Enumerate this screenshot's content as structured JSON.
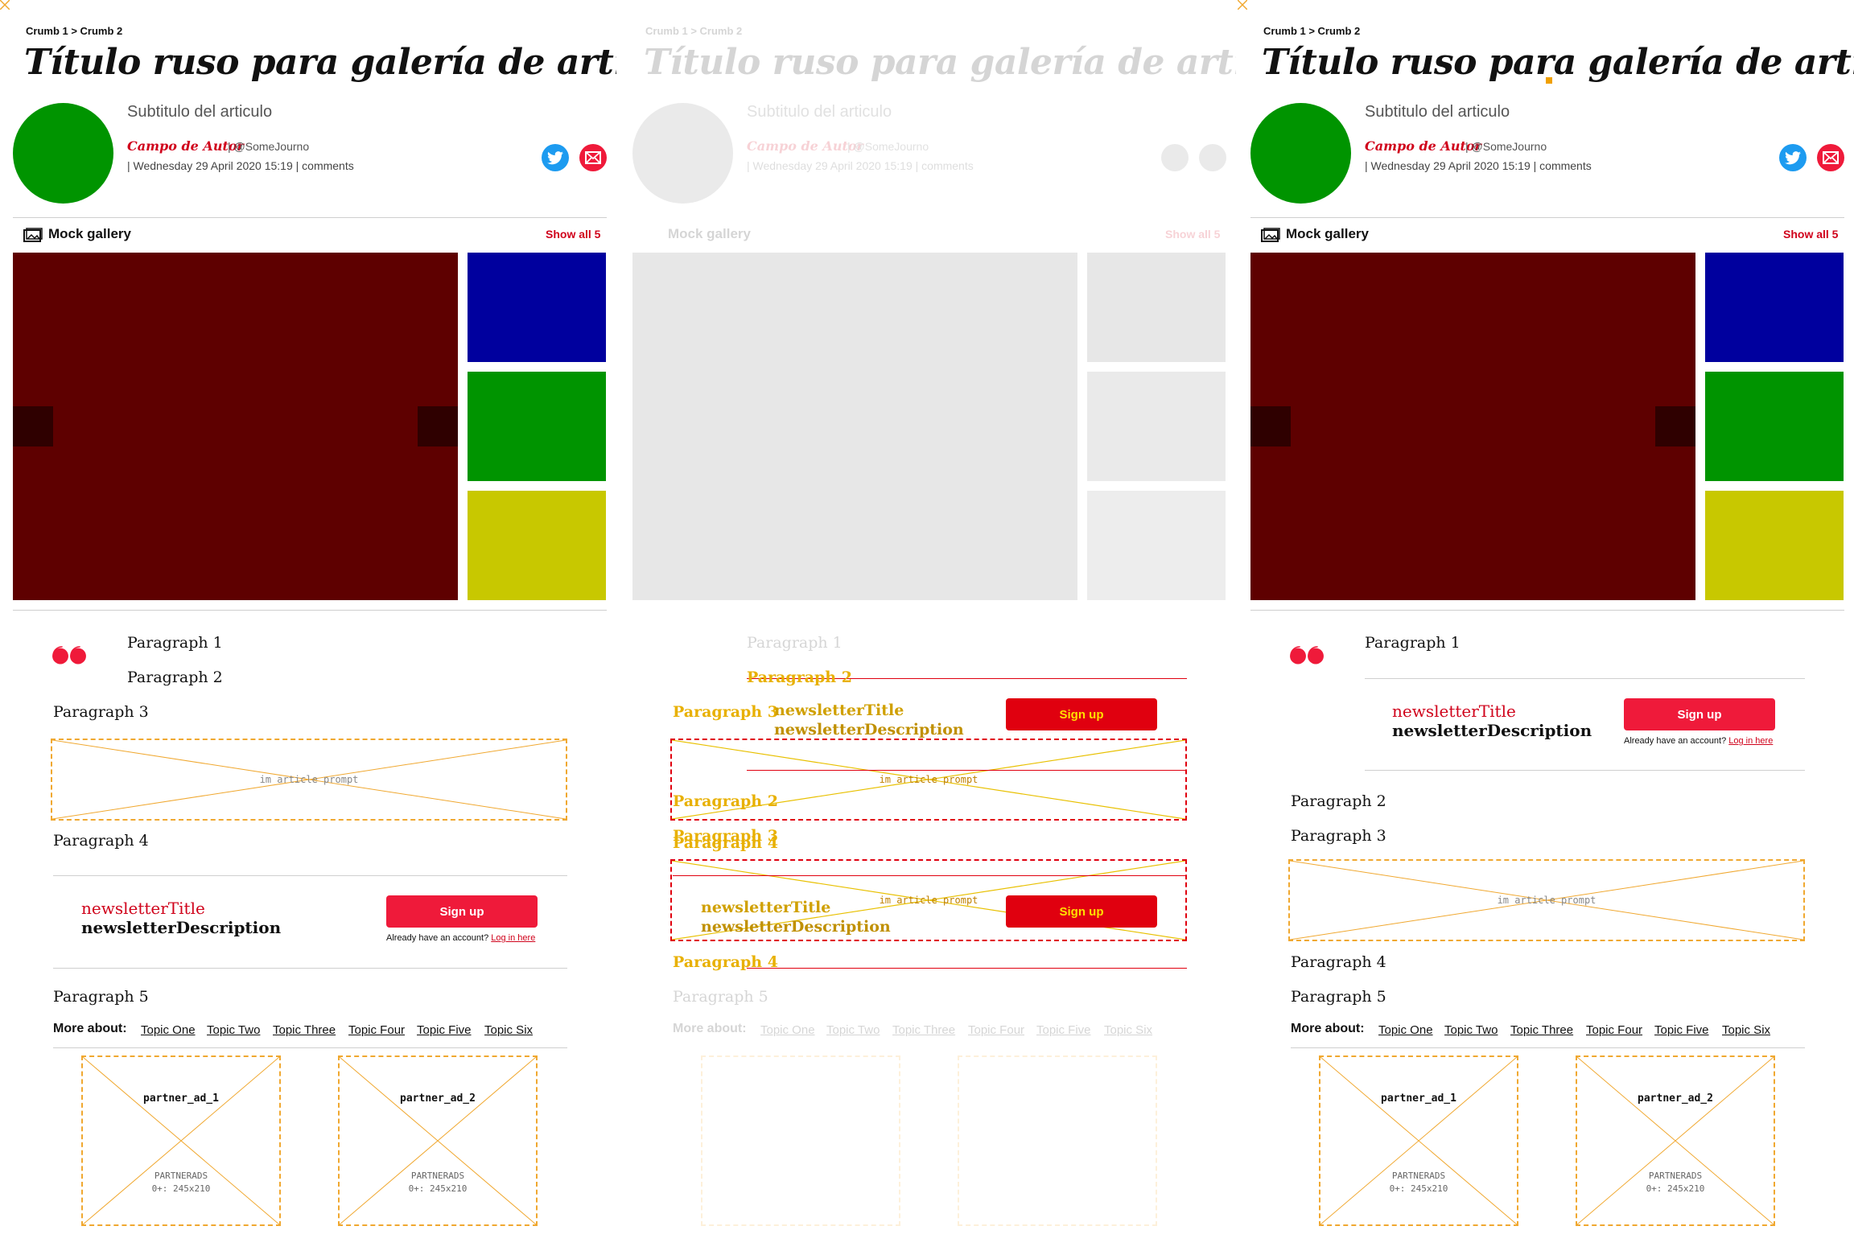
{
  "article": {
    "breadcrumb": "Crumb 1 > Crumb 2",
    "title": "Título ruso para galería de artículos",
    "subtitle": "Subtitulo del articulo",
    "author": "Campo de Autor",
    "handle": "| @SomeJourno",
    "meta": "| Wednesday 29 April 2020 15:19 |  comments"
  },
  "gallery": {
    "label": "Mock gallery",
    "show_all": "Show all 5",
    "colors": {
      "main": "#5e0000",
      "thumb1": "#00009e",
      "thumb2": "#009400",
      "thumb3": "#c8c800"
    }
  },
  "body": {
    "p1": "Paragraph 1",
    "p2": "Paragraph 2",
    "p3": "Paragraph 3",
    "p4": "Paragraph 4",
    "p5": "Paragraph 5",
    "prompt_label": "im article prompt"
  },
  "newsletter": {
    "title": "newsletterTitle",
    "description": "newsletterDescription",
    "signup": "Sign up",
    "already": "Already have an account?",
    "login": "Log in here"
  },
  "more_about": {
    "label": "More about:",
    "topics": [
      "Topic One",
      "Topic Two",
      "Topic Three",
      "Topic Four",
      "Topic Five",
      "Topic Six"
    ]
  },
  "ads": {
    "ad1": "partner_ad_1",
    "ad2": "partner_ad_2",
    "partner_label": "PARTNERADS",
    "size_label": "0+: 245x210"
  },
  "colors": {
    "accent": "#d0021b",
    "avatar": "#009400",
    "twitter": "#1d9bf0",
    "mail": "#ef1a3a",
    "placeholder": "#f0a830"
  },
  "icons": [
    "gallery-icon",
    "twitter-icon",
    "mail-icon",
    "quote-icon"
  ]
}
